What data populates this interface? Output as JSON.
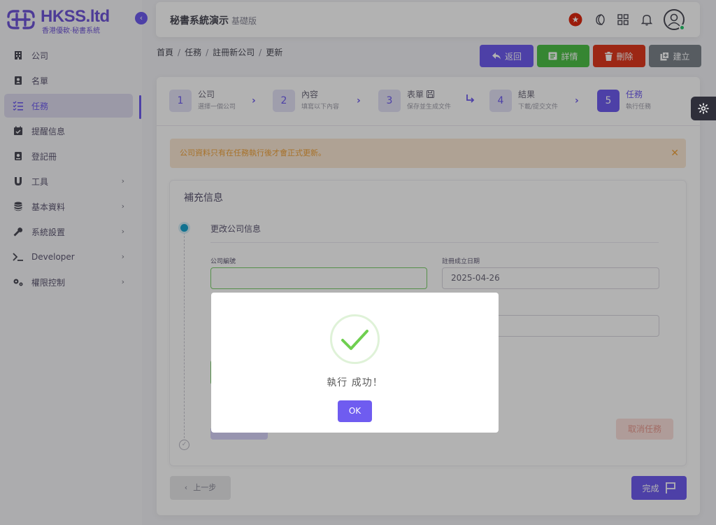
{
  "brand": {
    "name": "HKSS.ltd",
    "subtitle": "香港優軟·秘書系統"
  },
  "topbar": {
    "title": "秘書系統演示",
    "edition": "基礎版"
  },
  "sidebar": {
    "items": [
      {
        "label": "公司",
        "icon": "building-icon",
        "active": false,
        "chevron": false
      },
      {
        "label": "名單",
        "icon": "contact-card-icon",
        "active": false,
        "chevron": false
      },
      {
        "label": "任務",
        "icon": "checklist-icon",
        "active": true,
        "chevron": false
      },
      {
        "label": "提醒信息",
        "icon": "calendar-check-icon",
        "active": false,
        "chevron": false
      },
      {
        "label": "登記冊",
        "icon": "register-book-icon",
        "active": false,
        "chevron": false
      },
      {
        "label": "工具",
        "icon": "magnet-icon",
        "active": false,
        "chevron": true
      },
      {
        "label": "基本資料",
        "icon": "database-icon",
        "active": false,
        "chevron": true
      },
      {
        "label": "系統設置",
        "icon": "wrench-icon",
        "active": false,
        "chevron": true
      },
      {
        "label": "Developer",
        "icon": "terminal-icon",
        "active": false,
        "chevron": true
      },
      {
        "label": "權限控制",
        "icon": "cogs-icon",
        "active": false,
        "chevron": true
      }
    ]
  },
  "breadcrumb": [
    "首頁",
    "任務",
    "註冊新公司",
    "更新"
  ],
  "actions": {
    "back": "返回",
    "detail": "詳情",
    "delete": "刪除",
    "create": "建立"
  },
  "steps": [
    {
      "num": "1",
      "title": "公司",
      "sub": "選擇一個公司",
      "active": false
    },
    {
      "num": "2",
      "title": "內容",
      "sub": "填寫以下內容",
      "active": false
    },
    {
      "num": "3",
      "title": "表單",
      "sub": "保存並生成文件",
      "active": false
    },
    {
      "num": "4",
      "title": "結果",
      "sub": "下載/提交文件",
      "active": false
    },
    {
      "num": "5",
      "title": "任務",
      "sub": "執行任務",
      "active": true
    }
  ],
  "alert": {
    "text": "公司資料只有在任務執行後才會正式更新。",
    "close": "✕"
  },
  "section": {
    "title": "補充信息",
    "subtitle": "更改公司信息",
    "fields": [
      {
        "label": "公司編號",
        "value": ""
      },
      {
        "label": "註冊成立日期",
        "value": "2025-04-26"
      }
    ],
    "cancel_task": "取消任務"
  },
  "footer": {
    "prev": "上一步",
    "done": "完成"
  },
  "modal": {
    "message": "執行 成功！",
    "ok": "OK"
  },
  "colors": {
    "primary": "#6f5cf0",
    "success": "#4ec148",
    "danger": "#e0391f",
    "secondary": "#7d858c",
    "warning": "#f0a33c"
  }
}
